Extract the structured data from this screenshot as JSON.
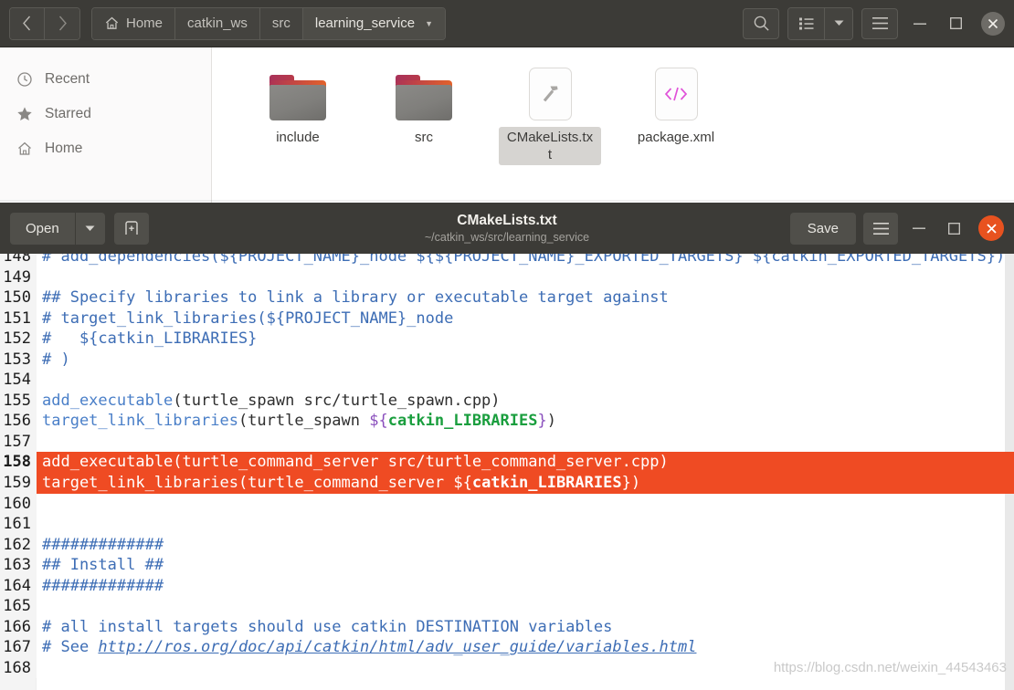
{
  "file_manager": {
    "nav": {
      "back_icon": "chevron-left-icon",
      "forward_icon": "chevron-right-icon"
    },
    "breadcrumbs": [
      {
        "label": "Home",
        "icon": "home-icon",
        "active": false
      },
      {
        "label": "catkin_ws",
        "icon": "",
        "active": false
      },
      {
        "label": "src",
        "icon": "",
        "active": false
      },
      {
        "label": "learning_service",
        "icon": "",
        "active": true,
        "caret": "▼"
      }
    ],
    "toolbar": {
      "search_icon": "search-icon",
      "view_list_icon": "list-view-icon",
      "view_caret": "▼",
      "menu_icon": "hamburger-menu-icon",
      "minimize": "–",
      "maximize": "□",
      "close": "✕"
    },
    "sidebar": {
      "items": [
        {
          "label": "Recent",
          "icon": "clock-icon"
        },
        {
          "label": "Starred",
          "icon": "star-icon"
        },
        {
          "label": "Home",
          "icon": "home-icon"
        }
      ]
    },
    "files": [
      {
        "name": "include",
        "type": "folder",
        "icon": "folder-icon",
        "selected": false
      },
      {
        "name": "src",
        "type": "folder",
        "icon": "folder-icon",
        "selected": false
      },
      {
        "name": "CMakeLists.txt",
        "type": "file",
        "icon": "hammer-build-file-icon",
        "selected": true
      },
      {
        "name": "package.xml",
        "type": "file",
        "icon": "code-xml-file-icon",
        "selected": false
      }
    ]
  },
  "editor": {
    "header": {
      "open_label": "Open",
      "open_caret": "▼",
      "new_doc_icon": "new-document-icon",
      "title": "CMakeLists.txt",
      "subtitle": "~/catkin_ws/src/learning_service",
      "save_label": "Save",
      "menu_icon": "hamburger-menu-icon",
      "minimize": "–",
      "maximize": "□",
      "close": "✕"
    },
    "colors": {
      "selection_highlight": "#ef4b23",
      "comment": "#3d6db5",
      "function": "#4a7fc8",
      "variable": "#1a9e3e",
      "bracket": "#8a4fbd",
      "gutter_bg": "#f4f4f4",
      "header_bg": "#3c3b37",
      "close_button": "#e8521f"
    },
    "lines": [
      {
        "num": "148",
        "current": false,
        "highlighted": false,
        "spans": [
          {
            "t": "# add_dependencies(${PROJECT_NAME}_node ${${PROJECT_NAME}_EXPORTED_TARGETS} ${catkin_EXPORTED_TARGETS})",
            "c": "c-cmt"
          }
        ]
      },
      {
        "num": "149",
        "current": false,
        "highlighted": false,
        "spans": []
      },
      {
        "num": "150",
        "current": false,
        "highlighted": false,
        "spans": [
          {
            "t": "## Specify libraries to link a library or executable target against",
            "c": "c-cmt"
          }
        ]
      },
      {
        "num": "151",
        "current": false,
        "highlighted": false,
        "spans": [
          {
            "t": "# target_link_libraries(${PROJECT_NAME}_node",
            "c": "c-cmt"
          }
        ]
      },
      {
        "num": "152",
        "current": false,
        "highlighted": false,
        "spans": [
          {
            "t": "#   ${catkin_LIBRARIES}",
            "c": "c-cmt"
          }
        ]
      },
      {
        "num": "153",
        "current": false,
        "highlighted": false,
        "spans": [
          {
            "t": "# )",
            "c": "c-cmt"
          }
        ]
      },
      {
        "num": "154",
        "current": false,
        "highlighted": false,
        "spans": []
      },
      {
        "num": "155",
        "current": false,
        "highlighted": false,
        "spans": [
          {
            "t": "add_executable",
            "c": "c-fn"
          },
          {
            "t": "(turtle_spawn src/turtle_spawn.cpp)",
            "c": ""
          }
        ]
      },
      {
        "num": "156",
        "current": false,
        "highlighted": false,
        "spans": [
          {
            "t": "target_link_libraries",
            "c": "c-fn"
          },
          {
            "t": "(turtle_spawn ",
            "c": ""
          },
          {
            "t": "${",
            "c": "c-br"
          },
          {
            "t": "catkin_LIBRARIES",
            "c": "c-var"
          },
          {
            "t": "}",
            "c": "c-br"
          },
          {
            "t": ")",
            "c": ""
          }
        ]
      },
      {
        "num": "157",
        "current": false,
        "highlighted": false,
        "spans": []
      },
      {
        "num": "158",
        "current": true,
        "highlighted": true,
        "spans": [
          {
            "t": "add_executable",
            "c": "c-fn"
          },
          {
            "t": "(turtle_command_server src/turtle_command_server.cpp)",
            "c": ""
          }
        ]
      },
      {
        "num": "159",
        "current": false,
        "highlighted": true,
        "spans": [
          {
            "t": "target_link_libraries",
            "c": "c-fn"
          },
          {
            "t": "(turtle_command_server ",
            "c": ""
          },
          {
            "t": "${",
            "c": "c-br"
          },
          {
            "t": "catkin_LIBRARIES",
            "c": "c-var"
          },
          {
            "t": "}",
            "c": "c-br"
          },
          {
            "t": ")",
            "c": ""
          }
        ]
      },
      {
        "num": "160",
        "current": false,
        "highlighted": false,
        "spans": []
      },
      {
        "num": "161",
        "current": false,
        "highlighted": false,
        "spans": []
      },
      {
        "num": "162",
        "current": false,
        "highlighted": false,
        "spans": [
          {
            "t": "#############",
            "c": "c-cmt"
          }
        ]
      },
      {
        "num": "163",
        "current": false,
        "highlighted": false,
        "spans": [
          {
            "t": "## Install ##",
            "c": "c-cmt"
          }
        ]
      },
      {
        "num": "164",
        "current": false,
        "highlighted": false,
        "spans": [
          {
            "t": "#############",
            "c": "c-cmt"
          }
        ]
      },
      {
        "num": "165",
        "current": false,
        "highlighted": false,
        "spans": []
      },
      {
        "num": "166",
        "current": false,
        "highlighted": false,
        "spans": [
          {
            "t": "# all install targets should use catkin DESTINATION variables",
            "c": "c-cmt"
          }
        ]
      },
      {
        "num": "167",
        "current": false,
        "highlighted": false,
        "spans": [
          {
            "t": "# See ",
            "c": "c-cmt"
          },
          {
            "t": "http://ros.org/doc/api/catkin/html/adv_user_guide/variables.html",
            "c": "c-url"
          }
        ]
      },
      {
        "num": "168",
        "current": false,
        "highlighted": false,
        "spans": []
      }
    ]
  },
  "watermark": "https://blog.csdn.net/weixin_44543463"
}
